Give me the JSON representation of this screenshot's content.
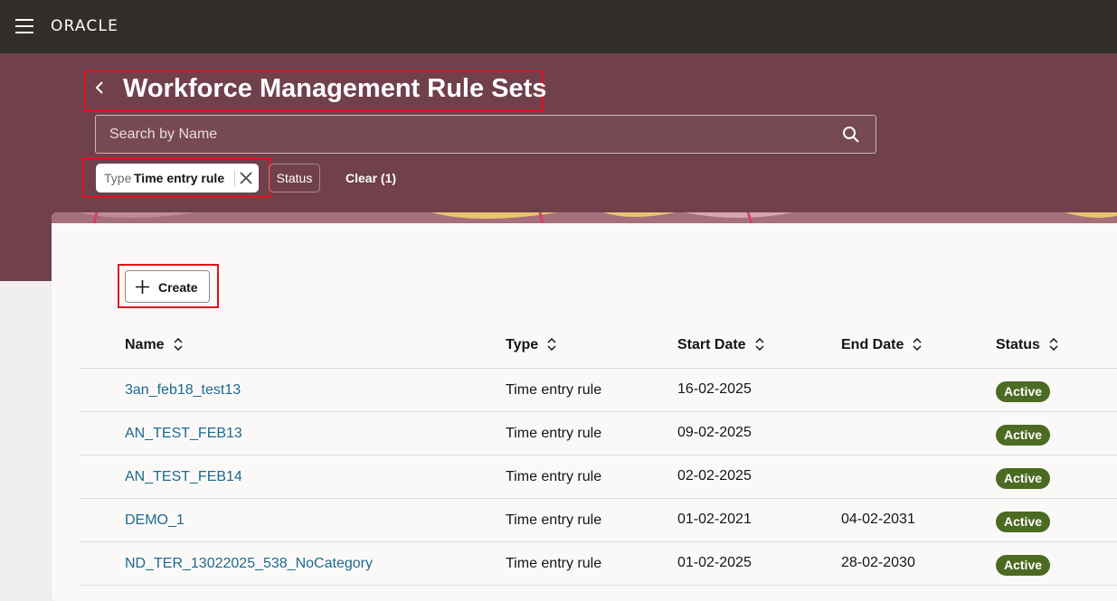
{
  "header": {
    "logo": "ORACLE"
  },
  "page": {
    "title": "Workforce Management Rule Sets",
    "search_placeholder": "Search by Name",
    "filters": {
      "type_chip_label": "Type",
      "type_chip_value": "Time entry rule",
      "status_label": "Status",
      "clear_label": "Clear (1)"
    },
    "create_label": "Create"
  },
  "table": {
    "columns": [
      "Name",
      "Type",
      "Start Date",
      "End Date",
      "Status"
    ],
    "rows": [
      {
        "name": "3an_feb18_test13",
        "type": "Time entry rule",
        "start": "16-02-2025",
        "end": "",
        "status": "Active"
      },
      {
        "name": "AN_TEST_FEB13",
        "type": "Time entry rule",
        "start": "09-02-2025",
        "end": "",
        "status": "Active"
      },
      {
        "name": "AN_TEST_FEB14",
        "type": "Time entry rule",
        "start": "02-02-2025",
        "end": "",
        "status": "Active"
      },
      {
        "name": "DEMO_1",
        "type": "Time entry rule",
        "start": "01-02-2021",
        "end": "04-02-2031",
        "status": "Active"
      },
      {
        "name": "ND_TER_13022025_538_NoCategory",
        "type": "Time entry rule",
        "start": "01-02-2025",
        "end": "28-02-2030",
        "status": "Active"
      }
    ]
  },
  "colors": {
    "topbar": "#312d2a",
    "hero": "#70404c",
    "link": "#1b6a8f",
    "badge": "#4b6a22",
    "highlight": "#e0141e"
  }
}
